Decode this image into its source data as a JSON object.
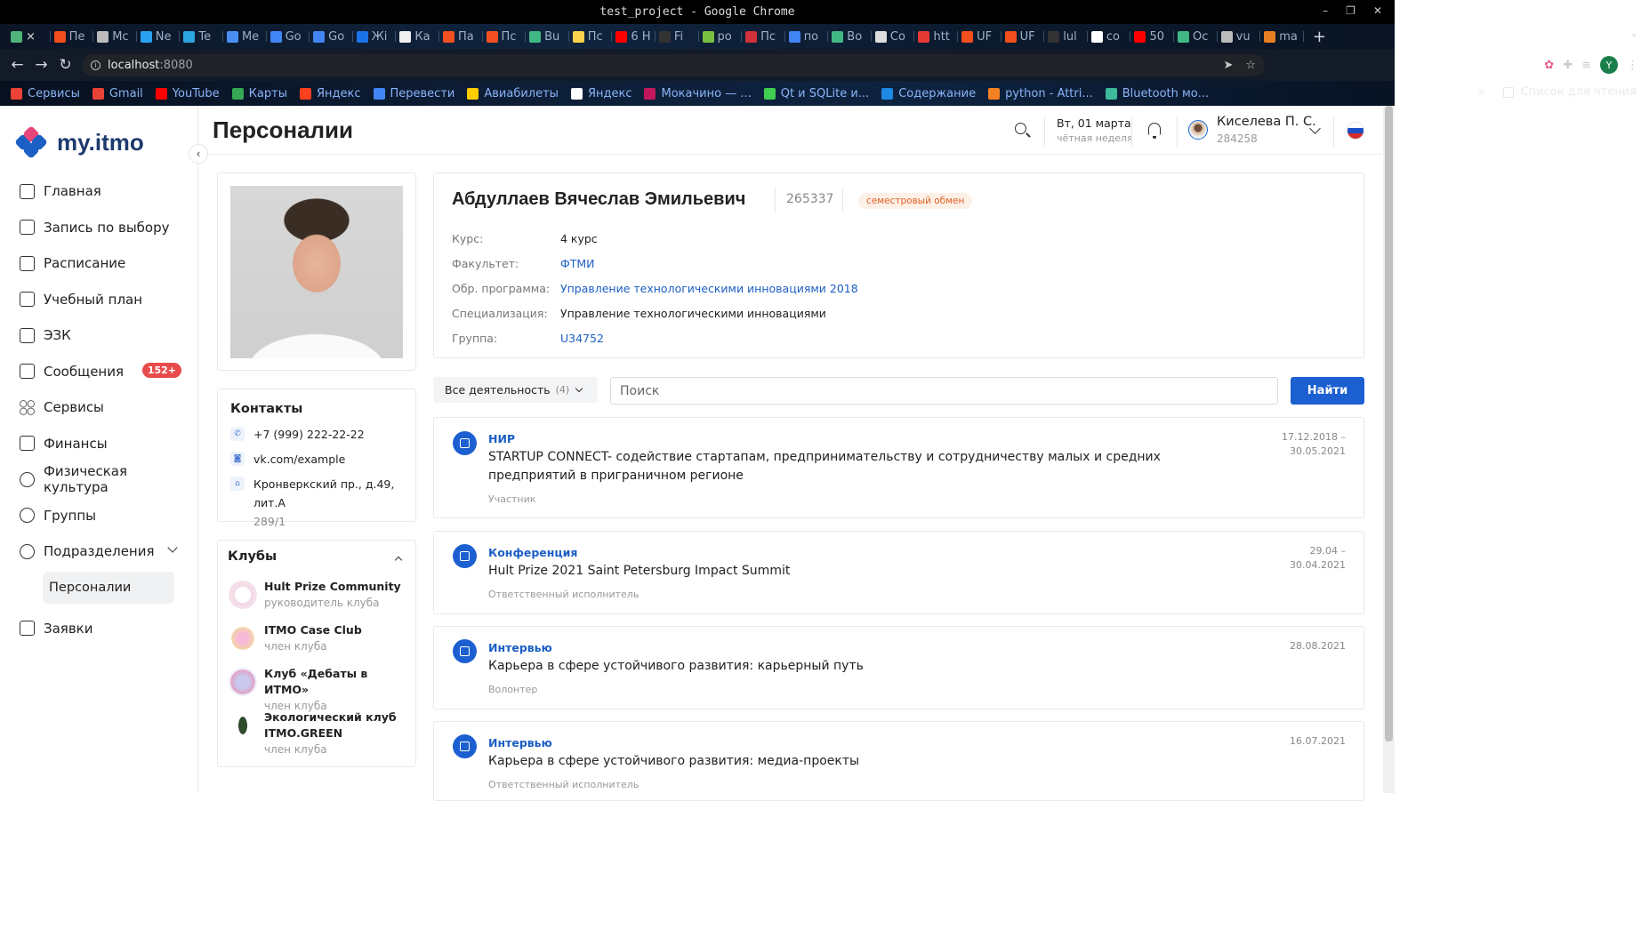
{
  "window": {
    "title": "test_project - Google Chrome",
    "controls": [
      "–",
      "❐",
      "✕"
    ]
  },
  "tabs": [
    {
      "label": "×",
      "color": "#4fb47a"
    },
    {
      "label": "Пе",
      "color": "#f24e1e"
    },
    {
      "label": "Мс",
      "color": "#bbbbbb"
    },
    {
      "label": "Ne",
      "color": "#2aa1f0"
    },
    {
      "label": "Te",
      "color": "#2ca5e0"
    },
    {
      "label": "Me",
      "color": "#4b8ef2"
    },
    {
      "label": "Go",
      "color": "#4285f4"
    },
    {
      "label": "Go",
      "color": "#4285f4"
    },
    {
      "label": "Жі",
      "color": "#1a73e8"
    },
    {
      "label": "Ка",
      "color": "#f0f0f0"
    },
    {
      "label": "Па",
      "color": "#f25022"
    },
    {
      "label": "Пс",
      "color": "#f25022"
    },
    {
      "label": "Bu",
      "color": "#41b883"
    },
    {
      "label": "Пс",
      "color": "#ffd24d"
    },
    {
      "label": "6 Н",
      "color": "#ff0000"
    },
    {
      "label": "Fi",
      "color": "#333333"
    },
    {
      "label": "ро",
      "color": "#7ac143"
    },
    {
      "label": "Пс",
      "color": "#d0313a"
    },
    {
      "label": "по",
      "color": "#4285f4"
    },
    {
      "label": "Во",
      "color": "#41b883"
    },
    {
      "label": "Co",
      "color": "#dddddd"
    },
    {
      "label": "htt",
      "color": "#e53935"
    },
    {
      "label": "UF",
      "color": "#f24e1e"
    },
    {
      "label": "UF",
      "color": "#f24e1e"
    },
    {
      "label": "lul",
      "color": "#333333"
    },
    {
      "label": "co",
      "color": "#ffffff"
    },
    {
      "label": "50",
      "color": "#ff0000"
    },
    {
      "label": "Oc",
      "color": "#41b883"
    },
    {
      "label": "vu",
      "color": "#bbbbbb"
    },
    {
      "label": "ma",
      "color": "#e67e22"
    }
  ],
  "toolbar": {
    "back": "←",
    "forward": "→",
    "reload": "↻",
    "url_host": "localhost",
    "url_port": ":8080",
    "profile_initial": "Y"
  },
  "bookmarks": {
    "items": [
      {
        "label": "Сервисы",
        "color": "#ea4335"
      },
      {
        "label": "Gmail",
        "color": "#ea4335"
      },
      {
        "label": "YouTube",
        "color": "#ff0000"
      },
      {
        "label": "Карты",
        "color": "#34a853"
      },
      {
        "label": "Яндекс",
        "color": "#fc3f1d"
      },
      {
        "label": "Перевести",
        "color": "#4285f4"
      },
      {
        "label": "Авиабилеты",
        "color": "#ffcc00"
      },
      {
        "label": "Яндекс",
        "color": "#ffffff"
      },
      {
        "label": "Мокачино — ...",
        "color": "#c2185b"
      },
      {
        "label": "Qt и SQLite и...",
        "color": "#41cd52"
      },
      {
        "label": "Содержание",
        "color": "#1e88e5"
      },
      {
        "label": "python - Attri...",
        "color": "#f48024"
      },
      {
        "label": "Bluetooth мо...",
        "color": "#3dba9a"
      }
    ],
    "more": "»",
    "reading_list": "Список для чтения"
  },
  "app": {
    "logo_text": "my.itmo",
    "collapse": "‹"
  },
  "nav": {
    "home": "Главная",
    "elective": "Запись по выбору",
    "schedule": "Расписание",
    "curriculum": "Учебный план",
    "ezk": "ЭЗК",
    "messages": "Сообщения",
    "messages_badge": "152+",
    "services": "Сервисы",
    "finance": "Финансы",
    "sport": "Физическая культура",
    "groups": "Группы",
    "departments": "Подразделения",
    "personalities": "Персоналии",
    "requests": "Заявки"
  },
  "header": {
    "page_title": "Персоналии",
    "date": "Вт, 01 марта",
    "week": "чётная неделя",
    "user_name": "Киселева П. С.",
    "user_id": "284258"
  },
  "profile": {
    "name": "Абдуллаев Вячеслав Эмильевич",
    "id": "265337",
    "tag": "семестровый обмен",
    "fields": [
      {
        "key": "Курс:",
        "value": "4 курс",
        "link": false
      },
      {
        "key": "Факультет:",
        "value": "ФТМИ",
        "link": true
      },
      {
        "key": "Обр. программа:",
        "value": "Управление технологическими инновациями 2018",
        "link": true
      },
      {
        "key": "Специализация:",
        "value": "Управление технологическими инновациями",
        "link": false
      },
      {
        "key": "Группа:",
        "value": "U34752",
        "link": true
      }
    ]
  },
  "contacts": {
    "title": "Контакты",
    "phone": "+7 (999) 222-22-22",
    "vk": "vk.com/example",
    "address_line1": "Кронверкский пр., д.49, лит.А",
    "address_line2": "289/1"
  },
  "clubs": {
    "title": "Клубы",
    "items": [
      {
        "name": "Hult Prize Community",
        "role": "руководитель клуба"
      },
      {
        "name": "ITMO Case Club",
        "role": "член клуба"
      },
      {
        "name": "Клуб «Дебаты в ИТМО»",
        "role": "член клуба"
      },
      {
        "name": "Экологический клуб ITMO.GREEN",
        "role": "член клуба"
      }
    ]
  },
  "filter": {
    "label": "Все деятельность",
    "count": "(4)",
    "search_placeholder": "Поиск",
    "find_button": "Найти"
  },
  "activities": [
    {
      "type": "НИР",
      "title": "STARTUP CONNECT- содействие стартапам, предпринимательству и сотрудничеству малых и средних предприятий в приграничном регионе",
      "role": "Участник",
      "date_from": "17.12.2018 –",
      "date_to": "30.05.2021"
    },
    {
      "type": "Конференция",
      "title": "Hult Prize 2021 Saint Petersburg Impact Summit",
      "role": "Ответственный исполнитель",
      "date_from": "29.04 –",
      "date_to": "30.04.2021"
    },
    {
      "type": "Интервью",
      "title": "Карьера в сфере устойчивого развития: карьерный путь",
      "role": "Волонтер",
      "date_from": "28.08.2021",
      "date_to": ""
    },
    {
      "type": "Интервью",
      "title": "Карьера в сфере устойчивого развития: медиа-проекты",
      "role": "Ответственный исполнитель",
      "date_from": "16.07.2021",
      "date_to": ""
    }
  ],
  "colors": {
    "accent": "#1b5fd0",
    "badge": "#e84b4b",
    "tag_text": "#e0622a",
    "tag_bg": "#fdf0e6"
  }
}
